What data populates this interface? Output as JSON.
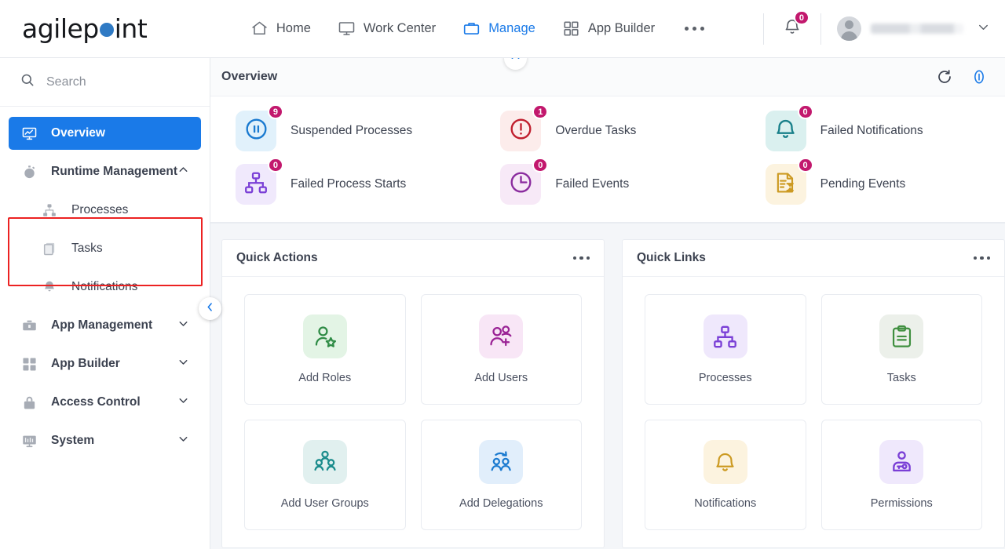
{
  "brand": {
    "name_part1": "agilep",
    "name_part2": "int"
  },
  "topnav": {
    "items": [
      {
        "label": "Home",
        "icon": "home-icon",
        "active": false
      },
      {
        "label": "Work Center",
        "icon": "monitor-icon",
        "active": false
      },
      {
        "label": "Manage",
        "icon": "briefcase-icon",
        "active": true
      },
      {
        "label": "App Builder",
        "icon": "grid-icon",
        "active": false
      }
    ],
    "more_label": "more-options",
    "notification_count": "0",
    "user_name": "",
    "accent_color": "#1a7ae8",
    "badge_color": "#c2186d"
  },
  "sidebar": {
    "search_placeholder": "Search",
    "items": [
      {
        "label": "Overview",
        "icon": "dashboard-icon",
        "state": "active"
      },
      {
        "label": "Runtime Management",
        "icon": "stopwatch-icon",
        "state": "expanded"
      },
      {
        "label": "Processes",
        "icon": "hierarchy-icon",
        "state": "sub"
      },
      {
        "label": "Tasks",
        "icon": "tasks-icon",
        "state": "sub"
      },
      {
        "label": "Notifications",
        "icon": "bell-icon",
        "state": "sub"
      },
      {
        "label": "App Management",
        "icon": "toolbox-icon",
        "state": "collapsed"
      },
      {
        "label": "App Builder",
        "icon": "grid-icon",
        "state": "collapsed"
      },
      {
        "label": "Access Control",
        "icon": "lock-icon",
        "state": "collapsed"
      },
      {
        "label": "System",
        "icon": "system-icon",
        "state": "collapsed"
      }
    ],
    "highlight_color": "#ec2222",
    "collapse_icon": "chevron-left-icon"
  },
  "overview": {
    "title": "Overview",
    "refresh_icon": "refresh-icon",
    "info_icon": "info-icon",
    "collapse_icon": "chevron-up-icon",
    "stats": [
      {
        "label": "Suspended Processes",
        "count": "9",
        "icon": "pause-circle-icon",
        "color": "#1a7ad0",
        "bg": "#e1f1fb"
      },
      {
        "label": "Overdue Tasks",
        "count": "1",
        "icon": "alert-circle-icon",
        "color": "#c01f2e",
        "bg": "#fceceb"
      },
      {
        "label": "Failed Notifications",
        "count": "0",
        "icon": "bell-icon",
        "color": "#19808a",
        "bg": "#daf0ef"
      },
      {
        "label": "Failed Process Starts",
        "count": "0",
        "icon": "hierarchy-icon",
        "color": "#7a3fd6",
        "bg": "#f0e9fc"
      },
      {
        "label": "Failed Events",
        "count": "0",
        "icon": "clock-icon",
        "color": "#8a2b9e",
        "bg": "#f7e9f7"
      },
      {
        "label": "Pending Events",
        "count": "0",
        "icon": "document-hourglass-icon",
        "color": "#cc9a22",
        "bg": "#fcf3df"
      }
    ]
  },
  "quick_actions": {
    "title": "Quick Actions",
    "menu_icon": "more-dots-icon",
    "tiles": [
      {
        "label": "Add Roles",
        "icon": "person-star-icon",
        "color": "#2e8b45",
        "bg": "#e3f4e5"
      },
      {
        "label": "Add Users",
        "icon": "people-plus-icon",
        "color": "#9a2395",
        "bg": "#f8e6f6"
      },
      {
        "label": "Add User Groups",
        "icon": "people-group-icon",
        "color": "#1b8c8c",
        "bg": "#e1f0ef"
      },
      {
        "label": "Add Delegations",
        "icon": "people-arrow-icon",
        "color": "#1a7ad0",
        "bg": "#e1eefb"
      }
    ]
  },
  "quick_links": {
    "title": "Quick Links",
    "menu_icon": "more-dots-icon",
    "tiles": [
      {
        "label": "Processes",
        "icon": "hierarchy-icon",
        "color": "#7a3fd6",
        "bg": "#efe8fc"
      },
      {
        "label": "Tasks",
        "icon": "clipboard-icon",
        "color": "#3f8f3f",
        "bg": "#ecf0ea"
      },
      {
        "label": "Notifications",
        "icon": "bell-icon",
        "color": "#cc9a22",
        "bg": "#fcf3df"
      },
      {
        "label": "Permissions",
        "icon": "person-key-icon",
        "color": "#7a3fd6",
        "bg": "#efe8fc"
      }
    ]
  }
}
